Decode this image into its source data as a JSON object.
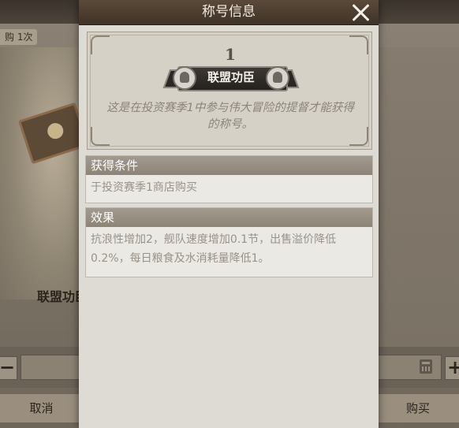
{
  "background": {
    "purchase_limit_tag": "购 1次",
    "item_name": "联盟功臣",
    "cancel_label": "取消",
    "buy_label": "购买",
    "minus_label": "−",
    "plus_label": "+"
  },
  "modal": {
    "title": "称号信息",
    "close_icon": "close-icon",
    "title_card": {
      "rank": "1",
      "badge_name": "联盟功臣",
      "description": "这是在投资赛季1中参与伟大冒险的提督才能获得的称号。"
    },
    "sections": {
      "acquire": {
        "header": "获得条件",
        "body": "于投资赛季1商店购买"
      },
      "effect": {
        "header": "效果",
        "body": "抗浪性增加2，舰队速度增加0.1节，出售溢价降低0.2%，每日粮食及水消耗量降低1。"
      }
    }
  }
}
